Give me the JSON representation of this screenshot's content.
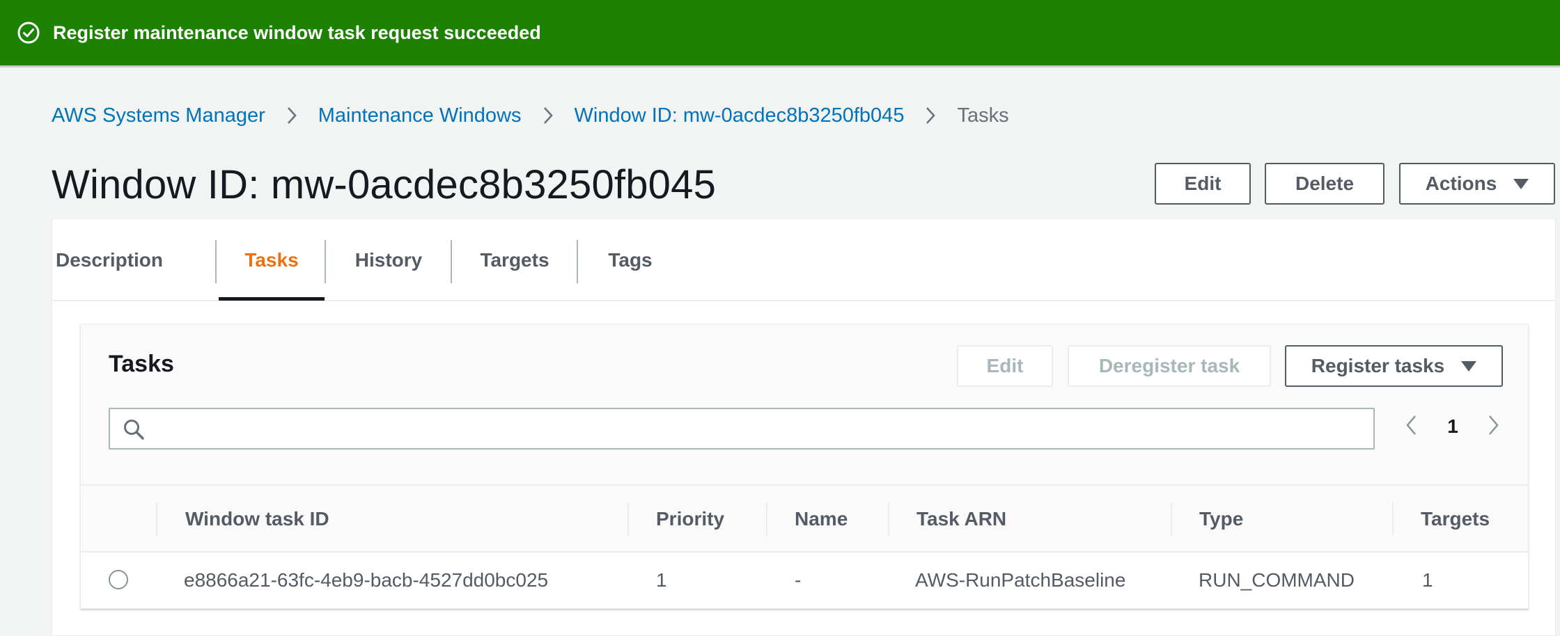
{
  "flash": {
    "icon": "check-circle-icon",
    "message": "Register maintenance window task request succeeded",
    "color": "#1d8102"
  },
  "breadcrumb": {
    "items": [
      "AWS Systems Manager",
      "Maintenance Windows",
      "Window ID: mw-0acdec8b3250fb045"
    ],
    "current": "Tasks"
  },
  "header": {
    "title": "Window ID: mw-0acdec8b3250fb045",
    "edit_label": "Edit",
    "delete_label": "Delete",
    "actions_label": "Actions"
  },
  "tabs": [
    {
      "label": "Description",
      "active": false
    },
    {
      "label": "Tasks",
      "active": true
    },
    {
      "label": "History",
      "active": false
    },
    {
      "label": "Targets",
      "active": false
    },
    {
      "label": "Tags",
      "active": false
    }
  ],
  "tasks": {
    "title": "Tasks",
    "edit_label": "Edit",
    "deregister_label": "Deregister task",
    "register_label": "Register tasks",
    "search_placeholder": "",
    "page": "1",
    "columns": [
      "Window task ID",
      "Priority",
      "Name",
      "Task ARN",
      "Type",
      "Targets"
    ],
    "rows": [
      {
        "id": "e8866a21-63fc-4eb9-bacb-4527dd0bc025",
        "priority": "1",
        "name": "-",
        "arn": "AWS-RunPatchBaseline",
        "type": "RUN_COMMAND",
        "targets": "1",
        "selected": false
      }
    ]
  },
  "colors": {
    "accent_orange": "#ec7211",
    "link_blue": "#0073bb",
    "success_green": "#1d8102"
  }
}
